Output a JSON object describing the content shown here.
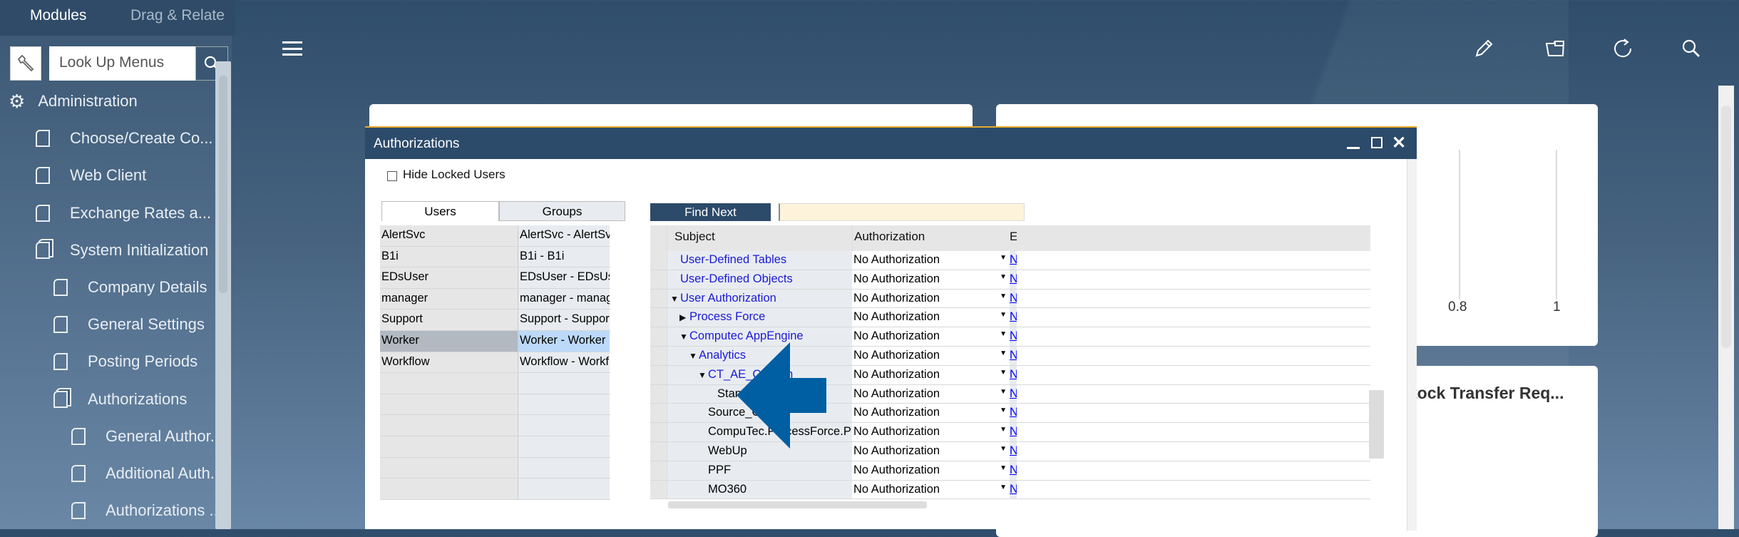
{
  "sidebar": {
    "tabs": [
      "Modules",
      "Drag & Relate"
    ],
    "search_placeholder": "Look Up Menus",
    "items": [
      {
        "label": "Administration",
        "level": 0,
        "icon": "gear-people-icon"
      },
      {
        "label": "Choose/Create Co...",
        "level": 1,
        "icon": "document-icon"
      },
      {
        "label": "Web Client",
        "level": 1,
        "icon": "document-icon"
      },
      {
        "label": "Exchange Rates a...",
        "level": 1,
        "icon": "document-icon"
      },
      {
        "label": "System Initialization",
        "level": 1,
        "icon": "folder-icon"
      },
      {
        "label": "Company Details",
        "level": 2,
        "icon": "document-icon"
      },
      {
        "label": "General Settings",
        "level": 2,
        "icon": "document-icon"
      },
      {
        "label": "Posting Periods",
        "level": 2,
        "icon": "document-icon"
      },
      {
        "label": "Authorizations",
        "level": 2,
        "icon": "folder-icon"
      },
      {
        "label": "General Author...",
        "level": 3,
        "icon": "document-icon"
      },
      {
        "label": "Additional Auth...",
        "level": 3,
        "icon": "document-icon"
      },
      {
        "label": "Authorizations ...",
        "level": 3,
        "icon": "document-icon"
      }
    ]
  },
  "toolbar": {
    "icons": [
      "menu-icon",
      "pencil-icon",
      "folder-open-icon",
      "refresh-icon",
      "search-icon"
    ]
  },
  "cards": {
    "ticks": [
      "0.8",
      "1"
    ],
    "card3_title": "tock Transfer Req..."
  },
  "dialog": {
    "title": "Authorizations",
    "hide_locked": "Hide Locked Users",
    "hide_locked_checked": false,
    "tabs": [
      "Users",
      "Groups"
    ],
    "active_tab": "Users",
    "users": [
      [
        "AlertSvc",
        "AlertSvc - AlertSvc"
      ],
      [
        "B1i",
        "B1i - B1i"
      ],
      [
        "EDsUser",
        "EDsUser - EDsUser"
      ],
      [
        "manager",
        "manager - manager"
      ],
      [
        "Support",
        "Support - Support"
      ],
      [
        "Worker",
        "Worker - Worker"
      ],
      [
        "Workflow",
        "Workflow - Workflow"
      ],
      [
        "",
        ""
      ],
      [
        "",
        ""
      ],
      [
        "",
        ""
      ],
      [
        "",
        ""
      ],
      [
        "",
        ""
      ],
      [
        "",
        ""
      ]
    ],
    "selected_user": "Worker",
    "find_next": "Find Next",
    "find_value": "",
    "columns": [
      "Subject",
      "Authorization",
      "E"
    ],
    "rows": [
      {
        "subject": "User-Defined Tables",
        "level": 0,
        "toggle": "",
        "link": true,
        "auth": "No Authorization",
        "e": "N"
      },
      {
        "subject": "User-Defined Objects",
        "level": 0,
        "toggle": "",
        "link": true,
        "auth": "No Authorization",
        "e": "N"
      },
      {
        "subject": "User Authorization",
        "level": 0,
        "toggle": "expanded",
        "link": true,
        "auth": "No Authorization",
        "e": "N"
      },
      {
        "subject": "Process Force",
        "level": 1,
        "toggle": "collapsed",
        "link": true,
        "auth": "No Authorization",
        "e": "N"
      },
      {
        "subject": "Computec AppEngine",
        "level": 1,
        "toggle": "expanded",
        "link": true,
        "auth": "No Authorization",
        "e": "N"
      },
      {
        "subject": "Analytics",
        "level": 2,
        "toggle": "expanded",
        "link": true,
        "auth": "No Authorization",
        "e": "N"
      },
      {
        "subject": "CT_AE_Custom",
        "level": 3,
        "toggle": "expanded",
        "link": true,
        "auth": "No Authorization",
        "e": "N"
      },
      {
        "subject": "Standard",
        "level": 4,
        "toggle": "",
        "link": false,
        "auth": "No Authorization",
        "e": "N"
      },
      {
        "subject": "Source_Creator",
        "level": 3,
        "toggle": "",
        "link": false,
        "auth": "No Authorization",
        "e": "N"
      },
      {
        "subject": "CompuTec.ProcessForce.Plugin",
        "level": 3,
        "toggle": "",
        "link": false,
        "auth": "No Authorization",
        "e": "N"
      },
      {
        "subject": "WebUp",
        "level": 3,
        "toggle": "",
        "link": false,
        "auth": "No Authorization",
        "e": "N"
      },
      {
        "subject": "PPF",
        "level": 3,
        "toggle": "",
        "link": false,
        "auth": "No Authorization",
        "e": "N"
      },
      {
        "subject": "MO360",
        "level": 3,
        "toggle": "",
        "link": false,
        "auth": "No Authorization",
        "e": "N"
      }
    ]
  },
  "annotation": {
    "arrow_color": "#005fa3",
    "points_to": "Standard"
  }
}
